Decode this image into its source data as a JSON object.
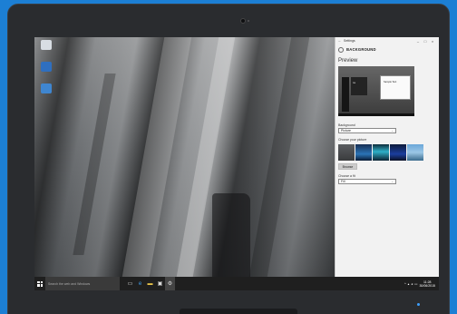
{
  "settings_window": {
    "title": "Settings",
    "header": "BACKGROUND",
    "preview_heading": "Preview",
    "preview_tile_text": "Aa",
    "preview_window_text": "Sample Text",
    "background_label": "Background",
    "background_value": "Picture",
    "choose_picture_label": "Choose your picture",
    "browse_label": "Browse",
    "choose_fit_label": "Choose a fit",
    "fit_value": "Fill"
  },
  "taskbar": {
    "search_placeholder": "Search the web and Windows",
    "time": "11:28",
    "date": "30/06/2015"
  },
  "colors": {
    "page_background": "#1c7fd4",
    "taskbar": "#1f1f1f",
    "settings_background": "#f2f2f2"
  },
  "icons": {
    "window_controls": [
      "minimize-icon",
      "maximize-icon",
      "close-icon"
    ],
    "taskbar_pinned": [
      "task-view-icon",
      "edge-icon",
      "file-explorer-icon",
      "store-icon",
      "settings-app-icon"
    ]
  }
}
